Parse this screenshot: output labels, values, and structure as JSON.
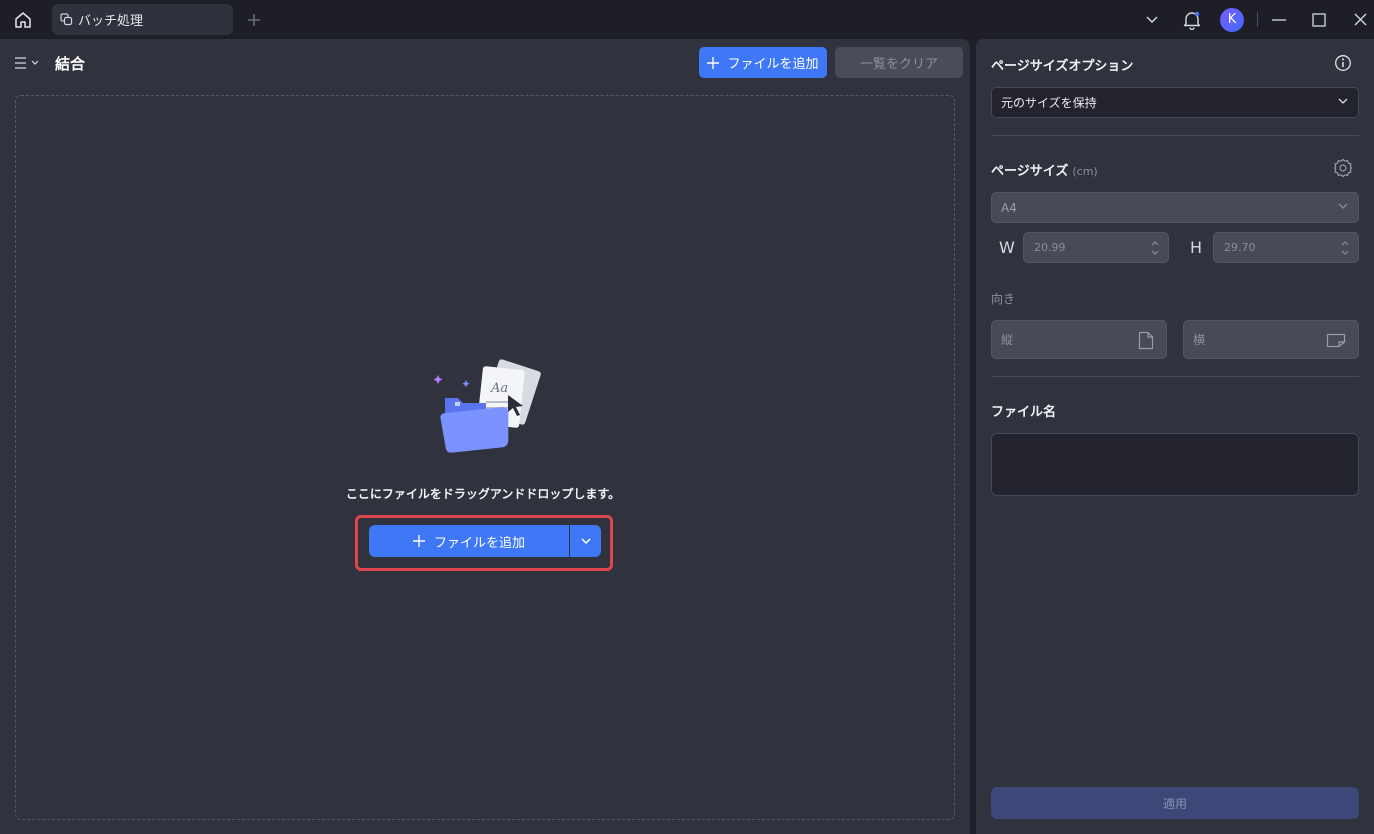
{
  "titlebar": {
    "tab_label": "バッチ処理",
    "avatar_initial": "K"
  },
  "main": {
    "title": "結合",
    "add_file_label": "ファイルを追加",
    "clear_list_label": "一覧をクリア",
    "drop_text": "ここにファイルをドラッグアンドドロップします。",
    "add_file_main_label": "ファイルを追加"
  },
  "side": {
    "page_size_option_heading": "ページサイズオプション",
    "page_size_option_value": "元のサイズを保持",
    "page_size_heading": "ページサイズ",
    "page_size_unit": "(cm)",
    "paper_value": "A4",
    "width_label": "W",
    "width_value": "20.99",
    "height_label": "H",
    "height_value": "29.70",
    "orientation_label": "向き",
    "portrait_label": "縦",
    "landscape_label": "横",
    "filename_heading": "ファイル名",
    "filename_value": "",
    "apply_label": "適用"
  },
  "colors": {
    "accent": "#3f78f7",
    "highlight_border": "#e0464d",
    "panel_bg": "#30323e",
    "titlebar_bg": "#1d1e26"
  },
  "icons": [
    "home-icon",
    "tab-pages-icon",
    "plus-icon",
    "chevron-down-icon",
    "bell-icon",
    "minimize-icon",
    "maximize-icon",
    "close-icon",
    "menu-icon",
    "info-icon",
    "gear-icon",
    "spinner-icon",
    "portrait-icon",
    "landscape-icon",
    "folder-files-illustration"
  ]
}
